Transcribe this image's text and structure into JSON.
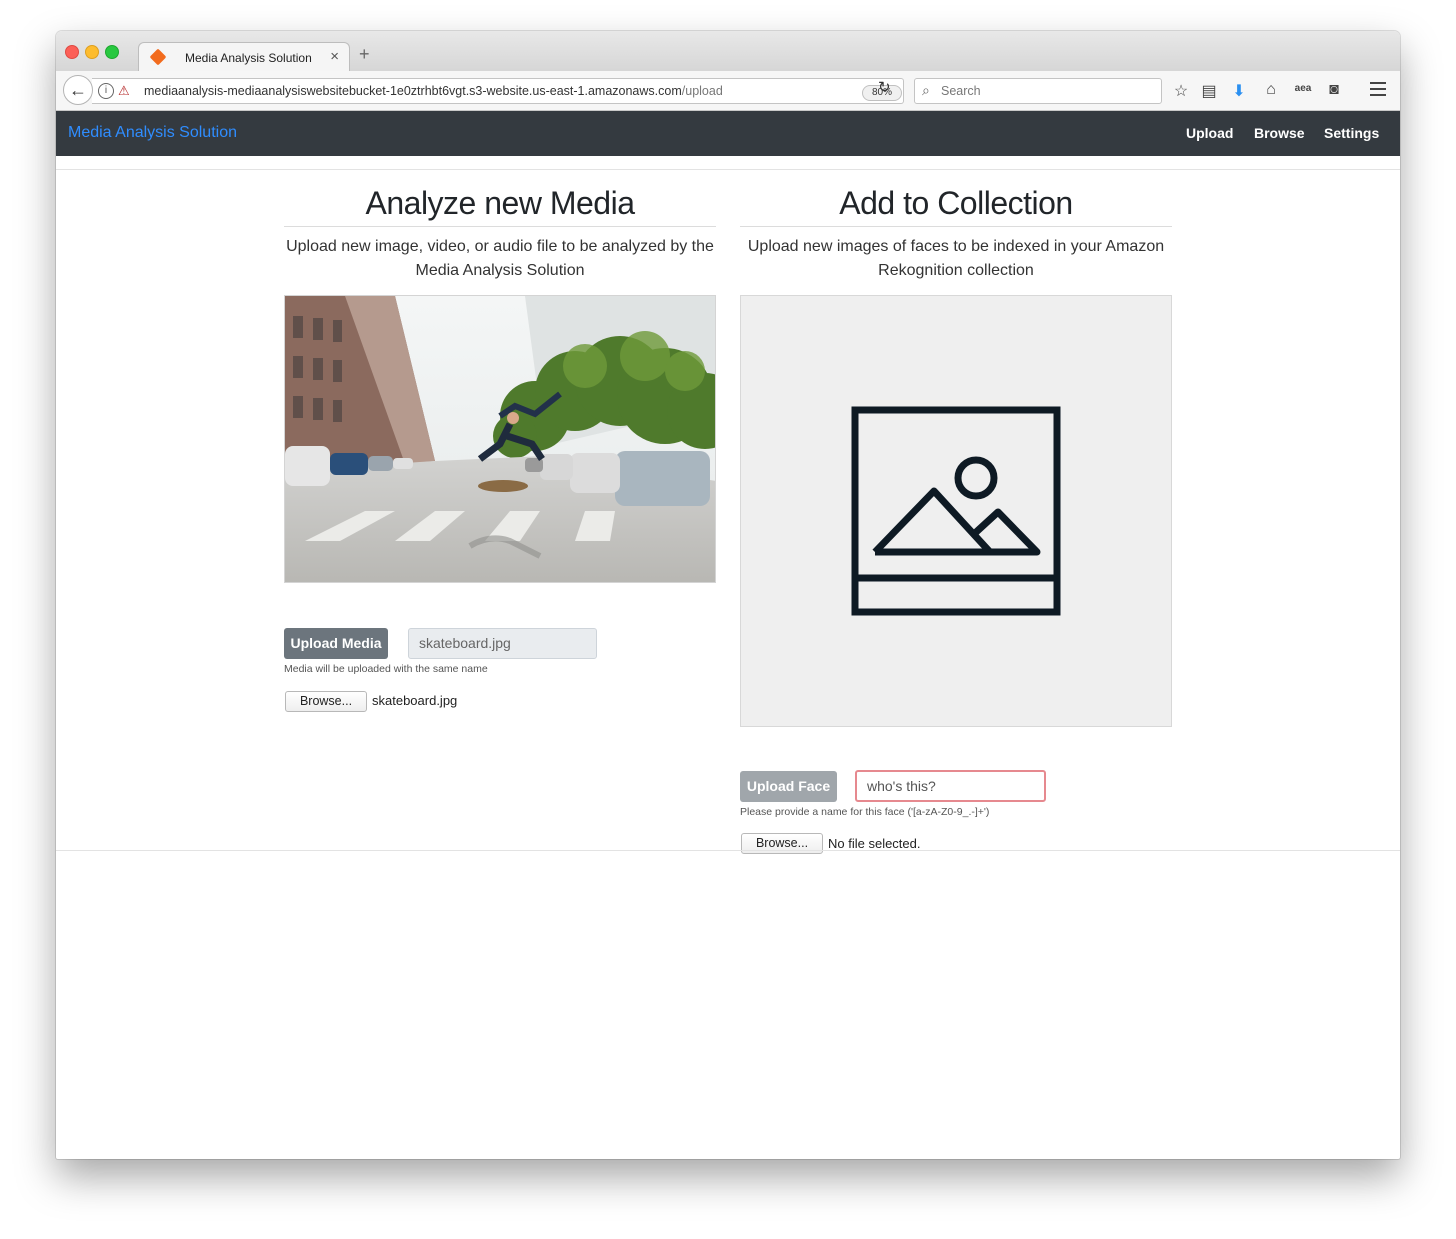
{
  "browser": {
    "tab_title": "Media Analysis Solution",
    "url_host": "mediaanalysis-mediaanalysiswebsitebucket-1e0ztrhbt6vgt.s3-website.us-east-1.amazonaws.com",
    "url_path": "/upload",
    "zoom": "80%",
    "search_placeholder": "Search",
    "toolbar_icons": [
      "bookmark-star-icon",
      "reading-list-icon",
      "download-icon",
      "home-icon",
      "amazon-assistant-icon",
      "pocket-icon",
      "hamburger-menu-icon"
    ]
  },
  "app": {
    "brand": "Media Analysis Solution",
    "nav": [
      "Upload",
      "Browse",
      "Settings"
    ],
    "accent_color": "#2f8dff",
    "navbar_color": "#343a40"
  },
  "analyze": {
    "title": "Analyze new Media",
    "description": "Upload new image, video, or audio file to be analyzed by the Media Analysis Solution",
    "preview_image": "skateboard-photo",
    "upload_button": "Upload Media",
    "filename_value": "skateboard.jpg",
    "help_text": "Media will be uploaded with the same name",
    "browse_button": "Browse...",
    "selected_file": "skateboard.jpg"
  },
  "collection": {
    "title": "Add to Collection",
    "description": "Upload new images of faces to be indexed in your Amazon Rekognition collection",
    "preview_image": "image-placeholder-icon",
    "upload_button": "Upload Face",
    "name_placeholder": "who's this?",
    "help_text": "Please provide a name for this face ('[a-zA-Z0-9_.-]+')",
    "browse_button": "Browse...",
    "selected_file": "No file selected."
  }
}
